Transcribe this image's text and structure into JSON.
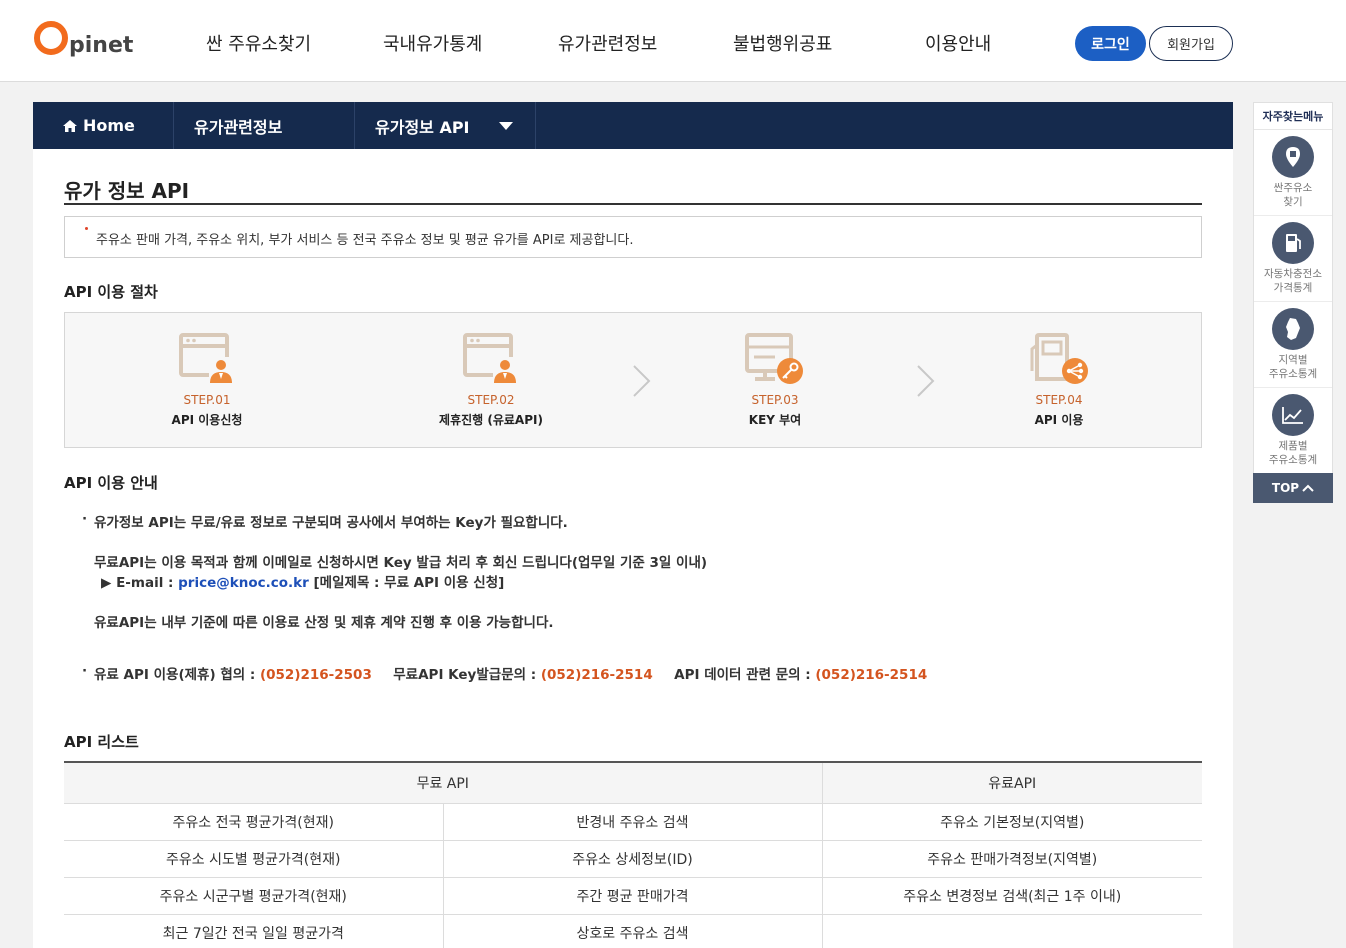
{
  "header": {
    "logo_text": "pinet",
    "nav": [
      "싼 주유소찾기",
      "국내유가통계",
      "유가관련정보",
      "불법행위공표",
      "이용안내"
    ],
    "login_label": "로그인",
    "join_label": "회원가입"
  },
  "breadcrumb": {
    "home": "Home",
    "level1": "유가관련정보",
    "level2": "유가정보 API"
  },
  "page": {
    "title": "유가 정보 API",
    "notice": "주유소 판매 가격, 주유소 위치, 부가 서비스 등 전국 주유소 정보 및 평균 유가를 API로 제공합니다."
  },
  "procedure": {
    "title": "API 이용 절차",
    "steps": [
      {
        "num": "STEP.01",
        "name": "API 이용신청",
        "icon": "browser-person-icon"
      },
      {
        "num": "STEP.02",
        "name": "제휴진행 (유료API)",
        "icon": "browser-person-icon"
      },
      {
        "num": "STEP.03",
        "name": "KEY 부여",
        "icon": "key-icon"
      },
      {
        "num": "STEP.04",
        "name": "API 이용",
        "icon": "gas-pump-share-icon"
      }
    ]
  },
  "guide": {
    "title": "API 이용 안내",
    "line1": "유가정보 API는 무료/유료 정보로 구분되며 공사에서 부여하는 Key가 필요합니다.",
    "line2": "무료API는 이용 목적과 함께 이메일로 신청하시면 Key 발급 처리 후 회신 드립니다(업무일 기준 3일 이내)",
    "email_prefix": "▶ E-mail : ",
    "email": "price@knoc.co.kr",
    "email_suffix": " [메일제목 : 무료 API 이용 신청]",
    "line3": "유료API는 내부 기준에 따른 이용료 산정 및 제휴 계약 진행 후 이용 가능합니다.",
    "contact1_label": "유료 API 이용(제휴) 협의 : ",
    "contact1_phone": "(052)216-2503",
    "contact2_label": "무료API Key발급문의 : ",
    "contact2_phone": "(052)216-2514",
    "contact3_label": "API 데이터 관련 문의 : ",
    "contact3_phone": "(052)216-2514"
  },
  "api_list": {
    "title": "API 리스트",
    "free_header": "무료 API",
    "paid_header": "유료API",
    "rows": [
      [
        "주유소 전국 평균가격(현재)",
        "반경내 주유소 검색",
        "주유소 기본정보(지역별)"
      ],
      [
        "주유소 시도별 평균가격(현재)",
        "주유소 상세정보(ID)",
        "주유소 판매가격정보(지역별)"
      ],
      [
        "주유소 시군구별 평균가격(현재)",
        "주간 평균 판매가격",
        "주유소 변경정보 검색(최근 1주 이내)"
      ],
      [
        "최근 7일간 전국 일일 평균가격",
        "상호로 주유소 검색",
        ""
      ]
    ]
  },
  "quick_menu": {
    "title": "자주찾는메뉴",
    "items": [
      {
        "line1": "싼주유소",
        "line2": "찾기"
      },
      {
        "line1": "자동차충전소",
        "line2": "가격통계"
      },
      {
        "line1": "지역별",
        "line2": "주유소통계"
      },
      {
        "line1": "제품별",
        "line2": "주유소통계"
      }
    ],
    "top_label": "TOP"
  },
  "colors": {
    "brand_orange": "#f26b1d",
    "nav_dark": "#152a4d",
    "login_blue": "#1c5fc4",
    "phone_orange": "#d4541f"
  }
}
